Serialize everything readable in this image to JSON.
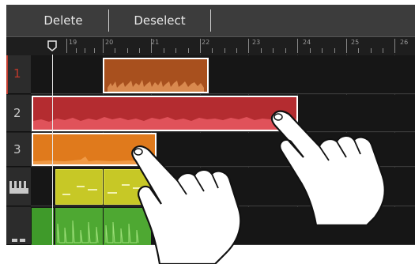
{
  "toolbar": {
    "delete_label": "Delete",
    "deselect_label": "Deselect"
  },
  "ruler": {
    "bar_numbers": [
      "19",
      "20",
      "21",
      "22",
      "23",
      "24",
      "25",
      "26"
    ]
  },
  "tracks": [
    {
      "label": "1",
      "type": "audio",
      "color": "#c0392b"
    },
    {
      "label": "2",
      "type": "audio",
      "color": "#c0392b"
    },
    {
      "label": "3",
      "type": "audio",
      "color": "#c0392b"
    },
    {
      "label": "",
      "type": "midi",
      "icon": "piano-keys-icon"
    },
    {
      "label": "",
      "type": "drum",
      "icon": "drum-icon"
    }
  ],
  "regions": {
    "track1_color": "#a8501e",
    "track2_color": "#b42c30",
    "track3_color": "#e07a1c",
    "track4_color": "#c7c826",
    "track5_color": "#4ea832"
  },
  "colors": {
    "panel_bg": "#1c1c1c",
    "toolbar_bg": "#3c3c3c",
    "selection_border": "#ffffff"
  }
}
